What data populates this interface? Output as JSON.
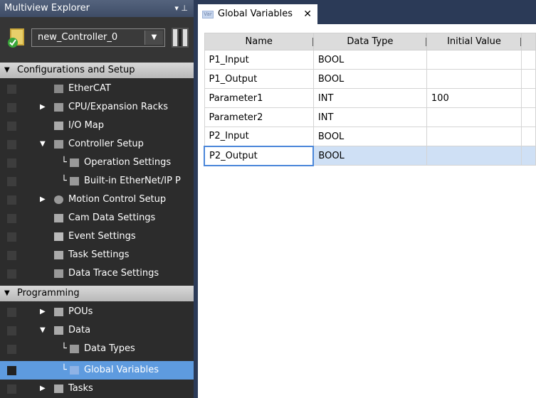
{
  "explorer": {
    "title": "Multiview Explorer",
    "pin_icon": "pin-icon",
    "controller_name": "new_Controller_0",
    "sections": [
      {
        "label": "Configurations and Setup"
      },
      {
        "label": "Programming"
      }
    ],
    "items": [
      {
        "label": "EtherCAT"
      },
      {
        "label": "CPU/Expansion Racks"
      },
      {
        "label": "I/O Map"
      },
      {
        "label": "Controller Setup"
      },
      {
        "label": "Operation Settings"
      },
      {
        "label": "Built-in EtherNet/IP P"
      },
      {
        "label": "Motion Control Setup"
      },
      {
        "label": "Cam Data Settings"
      },
      {
        "label": "Event Settings"
      },
      {
        "label": "Task Settings"
      },
      {
        "label": "Data Trace Settings"
      },
      {
        "label": "POUs"
      },
      {
        "label": "Data"
      },
      {
        "label": "Data Types"
      },
      {
        "label": "Global Variables"
      },
      {
        "label": "Tasks"
      }
    ]
  },
  "tab": {
    "label": "Global Variables",
    "close": "✕"
  },
  "table": {
    "columns": [
      "Name",
      "Data Type",
      "Initial Value"
    ],
    "rows": [
      {
        "name": "P1_Input",
        "type": "BOOL",
        "initial": ""
      },
      {
        "name": "P1_Output",
        "type": "BOOL",
        "initial": ""
      },
      {
        "name": "Parameter1",
        "type": "INT",
        "initial": "100"
      },
      {
        "name": "Parameter2",
        "type": "INT",
        "initial": ""
      },
      {
        "name": "P2_Input",
        "type": "BOOL",
        "initial": ""
      },
      {
        "name": "P2_Output",
        "type": "BOOL",
        "initial": ""
      }
    ],
    "selected_row": 5
  },
  "colors": {
    "selection": "#5e9bdf",
    "section_bg": "#c8c8c8",
    "panel_bg": "#2c2c2c",
    "title_bar": "#4a5872"
  }
}
